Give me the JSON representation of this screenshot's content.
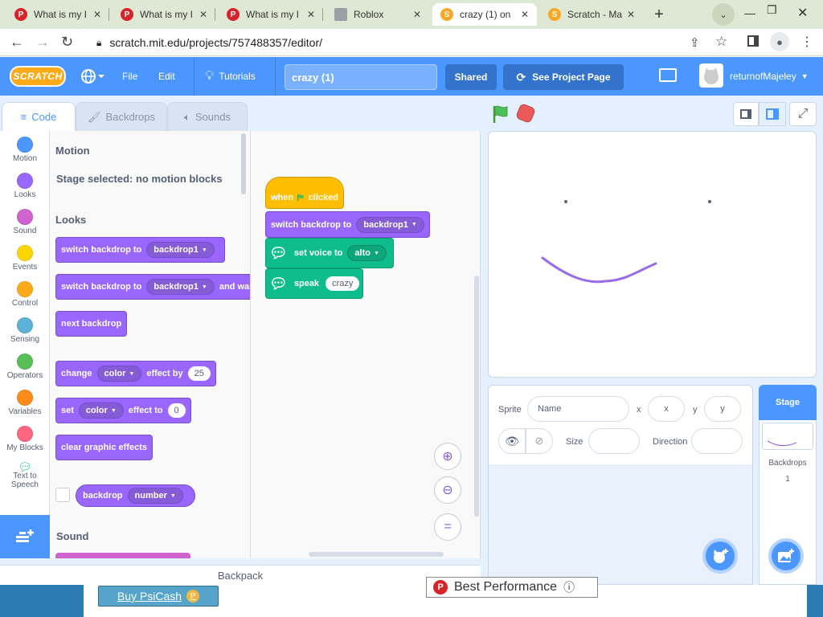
{
  "browser": {
    "tabs": [
      {
        "label": "What is my I",
        "icon": "psiphon-icon",
        "active": false
      },
      {
        "label": "What is my I",
        "icon": "psiphon-icon",
        "active": false
      },
      {
        "label": "What is my I",
        "icon": "psiphon-icon",
        "active": false
      },
      {
        "label": "Roblox",
        "icon": "roblox-icon",
        "active": false
      },
      {
        "label": "crazy (1) on",
        "icon": "scratch-icon",
        "active": true
      },
      {
        "label": "Scratch - Ma",
        "icon": "scratch-icon",
        "active": false
      }
    ],
    "url": "scratch.mit.edu/projects/757488357/editor/"
  },
  "menubar": {
    "logo": "SCRATCH",
    "file": "File",
    "edit": "Edit",
    "tutorials": "Tutorials",
    "project_title": "crazy (1)",
    "shared": "Shared",
    "see_project_page": "See Project Page",
    "username": "returnofMajeley"
  },
  "editor_tabs": {
    "code": "Code",
    "backdrops": "Backdrops",
    "sounds": "Sounds"
  },
  "categories": [
    {
      "label": "Motion",
      "color": "#4c97ff"
    },
    {
      "label": "Looks",
      "color": "#9966ff"
    },
    {
      "label": "Sound",
      "color": "#cf63cf"
    },
    {
      "label": "Events",
      "color": "#ffd500"
    },
    {
      "label": "Control",
      "color": "#ffab19"
    },
    {
      "label": "Sensing",
      "color": "#5cb1d6"
    },
    {
      "label": "Operators",
      "color": "#59c059"
    },
    {
      "label": "Variables",
      "color": "#ff8c1a"
    },
    {
      "label": "My Blocks",
      "color": "#ff6680"
    },
    {
      "label": "Text to Speech",
      "color": "#0fbd8c"
    }
  ],
  "palette": {
    "motion_title": "Motion",
    "motion_note": "Stage selected: no motion blocks",
    "looks_title": "Looks",
    "sound_title": "Sound",
    "blocks": {
      "b1": {
        "text": "switch backdrop to",
        "dd": "backdrop1"
      },
      "b2": {
        "text": "switch backdrop to",
        "dd": "backdrop1",
        "suffix": "and wait"
      },
      "b3": {
        "text": "next backdrop"
      },
      "b4": {
        "text": "change",
        "dd": "color",
        "mid": "effect by",
        "num": "25"
      },
      "b5": {
        "text": "set",
        "dd": "color",
        "mid": "effect to",
        "num": "0"
      },
      "b6": {
        "text": "clear graphic effects"
      },
      "b7": {
        "text": "backdrop",
        "dd": "number"
      }
    }
  },
  "script": {
    "hat_when": "when",
    "hat_clicked": "clicked",
    "switch_text": "switch backdrop to",
    "switch_dd": "backdrop1",
    "voice_text": "set voice to",
    "voice_dd": "alto",
    "speak_text": "speak",
    "speak_value": "crazy"
  },
  "sprite_info": {
    "sprite_label": "Sprite",
    "name_placeholder": "Name",
    "x_label": "x",
    "x_placeholder": "x",
    "y_label": "y",
    "y_placeholder": "y",
    "size_label": "Size",
    "direction_label": "Direction"
  },
  "stage_pane": {
    "title": "Stage",
    "backdrops_label": "Backdrops",
    "backdrops_count": "1"
  },
  "backpack": "Backpack",
  "ad": {
    "buy_label": "Buy PsiCash",
    "perf_label": "Best Performance"
  }
}
